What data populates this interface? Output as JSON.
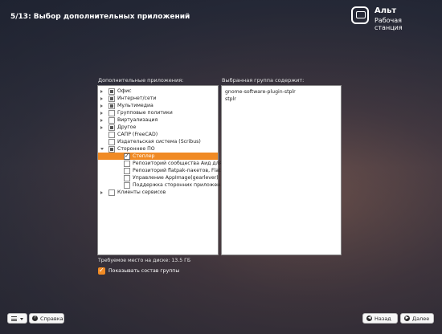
{
  "header": {
    "step_title": "5/13: Выбор дополнительных приложений",
    "logo_name": "Альт",
    "logo_subtitle": "Рабочая станция"
  },
  "left_panel": {
    "label": "Дополнительные приложения:",
    "items": [
      {
        "label": "Офис",
        "expander": "collapsed",
        "check": "partial",
        "level": 0
      },
      {
        "label": "Интернет/сети",
        "expander": "collapsed",
        "check": "partial",
        "level": 0
      },
      {
        "label": "Мультимедиа",
        "expander": "collapsed",
        "check": "partial",
        "level": 0
      },
      {
        "label": "Групповые политики",
        "expander": "collapsed",
        "check": "none",
        "level": 0
      },
      {
        "label": "Виртуализация",
        "expander": "collapsed",
        "check": "none",
        "level": 0
      },
      {
        "label": "Другое",
        "expander": "collapsed",
        "check": "partial",
        "level": 0
      },
      {
        "label": "САПР (FreeCAD)",
        "expander": "none",
        "check": "none",
        "level": 0
      },
      {
        "label": "Издательская система (Scribus)",
        "expander": "none",
        "check": "none",
        "level": 0
      },
      {
        "label": "Стороннее ПО",
        "expander": "expanded",
        "check": "partial",
        "level": 0
      },
      {
        "label": "Степлер",
        "expander": "none",
        "check": "checked",
        "level": 1,
        "selected": true
      },
      {
        "label": "Репозиторий сообщества Аид для...",
        "expander": "none",
        "check": "none",
        "level": 1
      },
      {
        "label": "Репозиторий flatpak-пакетов, Flath...",
        "expander": "none",
        "check": "none",
        "level": 1
      },
      {
        "label": "Управление AppImage(gearlever)",
        "expander": "none",
        "check": "none",
        "level": 1
      },
      {
        "label": "Поддержка сторонних приложен...",
        "expander": "none",
        "check": "none",
        "level": 1
      },
      {
        "label": "Клиенты сервисов",
        "expander": "collapsed",
        "check": "none",
        "level": 0
      }
    ]
  },
  "right_panel": {
    "label": "Выбранная группа содержит:",
    "lines": [
      "gnome-software-plugin-stplr",
      "stplr"
    ]
  },
  "footer": {
    "disk_space": "Требуемое место на диске: 13.5 ГБ",
    "show_group_label": "Показывать состав группы",
    "show_group_checked": true,
    "help_label": "Справка",
    "back_label": "Назад",
    "next_label": "Далее"
  },
  "colors": {
    "accent": "#f08a24"
  }
}
